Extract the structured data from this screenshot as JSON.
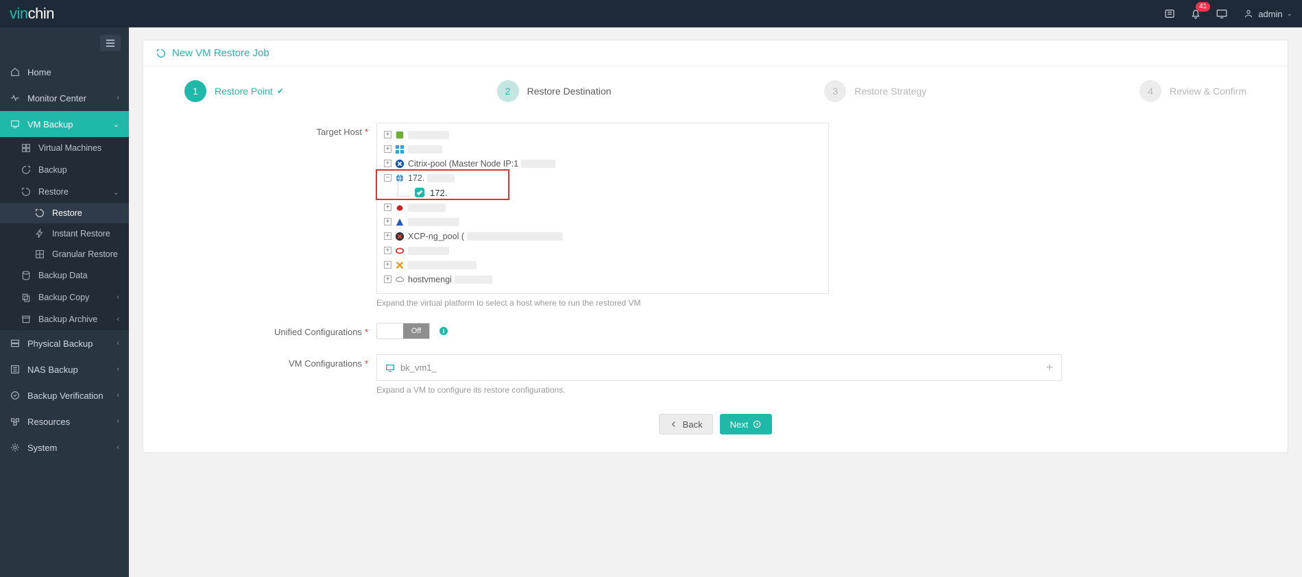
{
  "brand": {
    "part1": "vin",
    "part2": "chin"
  },
  "topbar": {
    "badge_count": "41",
    "user_name": "admin"
  },
  "sidebar": {
    "home": "Home",
    "monitor": "Monitor Center",
    "vmbackup": "VM Backup",
    "sub": {
      "vms": "Virtual Machines",
      "backup": "Backup",
      "restore": "Restore",
      "restore_children": {
        "restore": "Restore",
        "instant": "Instant Restore",
        "granular": "Granular Restore"
      },
      "bkdata": "Backup Data",
      "bkcopy": "Backup Copy",
      "bkarchive": "Backup Archive"
    },
    "physical": "Physical Backup",
    "nas": "NAS Backup",
    "bkverify": "Backup Verification",
    "resources": "Resources",
    "system": "System"
  },
  "panel_title": "New VM Restore Job",
  "steps": {
    "s1": {
      "num": "1",
      "label": "Restore Point"
    },
    "s2": {
      "num": "2",
      "label": "Restore Destination"
    },
    "s3": {
      "num": "3",
      "label": "Restore Strategy"
    },
    "s4": {
      "num": "4",
      "label": "Review & Confirm"
    }
  },
  "form": {
    "target_host_lbl": "Target Host",
    "unified_lbl": "Unified Configurations",
    "vmconf_lbl": "VM Configurations",
    "target_help": "Expand the virtual platform to select a host where to run the restored VM",
    "vmconf_help": "Expand a VM to configure its restore configurations.",
    "switch_off": "Off",
    "vm_name": "bk_vm1_"
  },
  "tree": {
    "n_citrix": "Citrix-pool (Master Node IP:1",
    "n_172": "172.",
    "n_172_child": "172.",
    "n_xcp": "XCP-ng_pool (",
    "n_hostvm": "hostvmengi"
  },
  "buttons": {
    "back": "Back",
    "next": "Next"
  }
}
